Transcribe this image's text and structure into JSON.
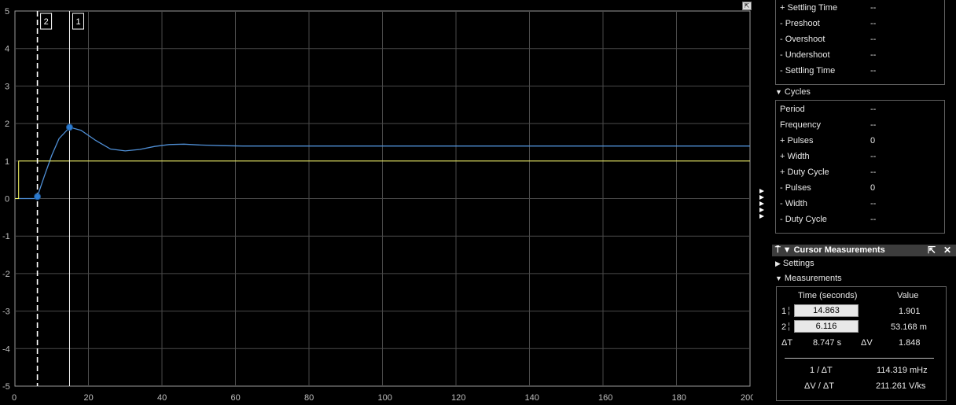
{
  "plot": {
    "x_ticks": [
      "0",
      "20",
      "40",
      "60",
      "80",
      "100",
      "120",
      "140",
      "160",
      "180",
      "200"
    ],
    "y_ticks": [
      "5",
      "4",
      "3",
      "2",
      "1",
      "0",
      "-1",
      "-2",
      "-3",
      "-4",
      "-5"
    ],
    "cursor1_label": "1",
    "cursor2_label": "2",
    "maximize_glyph": "⇱"
  },
  "chart_data": {
    "type": "line",
    "x_range": [
      0,
      200
    ],
    "y_range": [
      -5,
      5
    ],
    "series": [
      {
        "color": "#4f8fd6",
        "x": [
          0,
          5.5,
          6.1,
          8,
          10,
          12,
          14.9,
          18,
          22,
          26,
          30,
          34,
          38,
          42,
          46,
          50,
          56,
          62,
          70,
          80,
          100,
          140,
          200
        ],
        "y": [
          0,
          0,
          0.053,
          0.6,
          1.15,
          1.6,
          1.901,
          1.82,
          1.55,
          1.32,
          1.27,
          1.31,
          1.39,
          1.44,
          1.45,
          1.43,
          1.41,
          1.4,
          1.4,
          1.4,
          1.4,
          1.4,
          1.4
        ]
      },
      {
        "color": "#ffff66",
        "x": [
          0,
          1,
          1,
          200
        ],
        "y": [
          0,
          0,
          1,
          1
        ]
      }
    ],
    "cursors": [
      {
        "label": "1",
        "x": 14.863,
        "y": 1.901
      },
      {
        "label": "2",
        "x": 6.116,
        "y": 0.053168
      }
    ],
    "grid": true
  },
  "top_metrics": [
    {
      "label": "+ Settling Time",
      "value": "--"
    },
    {
      "label": "- Preshoot",
      "value": "--"
    },
    {
      "label": "- Overshoot",
      "value": "--"
    },
    {
      "label": "- Undershoot",
      "value": "--"
    },
    {
      "label": "- Settling Time",
      "value": "--"
    }
  ],
  "cycles": {
    "title": "Cycles",
    "rows": [
      {
        "label": "Period",
        "value": "--"
      },
      {
        "label": "Frequency",
        "value": "--"
      },
      {
        "label": "+ Pulses",
        "value": "0"
      },
      {
        "label": "+ Width",
        "value": "--"
      },
      {
        "label": "+ Duty Cycle",
        "value": "--"
      },
      {
        "label": "- Pulses",
        "value": "0"
      },
      {
        "label": "- Width",
        "value": "--"
      },
      {
        "label": "- Duty Cycle",
        "value": "--"
      }
    ]
  },
  "cursor_measurements": {
    "title": "Cursor Measurements",
    "settings_label": "Settings",
    "measurements_label": "Measurements",
    "col_time": "Time (seconds)",
    "col_value": "Value",
    "rows": [
      {
        "index": "1",
        "time": "14.863",
        "value": "1.901"
      },
      {
        "index": "2",
        "time": "6.116",
        "value": "53.168 m"
      }
    ],
    "delta_t_label": "ΔT",
    "delta_t_value": "8.747 s",
    "delta_v_label": "ΔV",
    "delta_v_value": "1.848",
    "inv_dt_label": "1 / ΔT",
    "inv_dt_value": "114.319 mHz",
    "dv_dt_label": "ΔV / ΔT",
    "dv_dt_value": "211.261 V/ks"
  }
}
